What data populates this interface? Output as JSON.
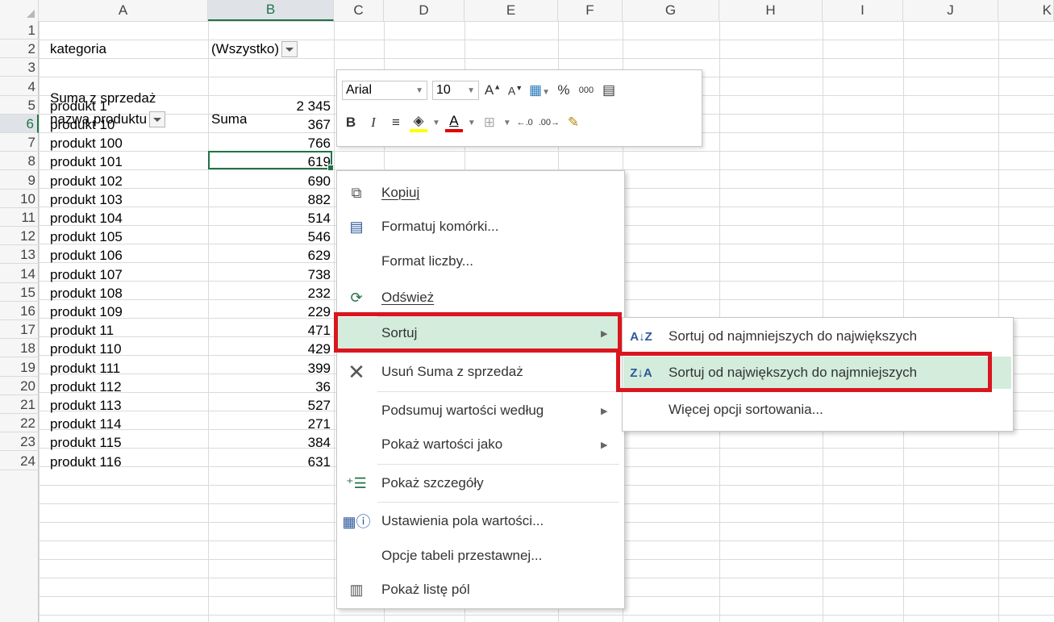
{
  "columns": [
    "A",
    "B",
    "C",
    "D",
    "E",
    "F",
    "G",
    "H",
    "I",
    "J",
    "K"
  ],
  "rows": [
    "1",
    "2",
    "3",
    "4",
    "5",
    "6",
    "7",
    "8",
    "9",
    "10",
    "11",
    "12",
    "13",
    "14",
    "15",
    "16",
    "17",
    "18",
    "19",
    "20",
    "21",
    "22",
    "23",
    "24"
  ],
  "cells": {
    "a1": "kategoria",
    "b1": "(Wszystko)",
    "a3": "Suma z sprzedaż",
    "a4": "nazwa produktu",
    "b4": "Suma",
    "data": [
      [
        "produkt 1",
        "2 345"
      ],
      [
        "produkt 10",
        "367"
      ],
      [
        "produkt 100",
        "766"
      ],
      [
        "produkt 101",
        "619"
      ],
      [
        "produkt 102",
        "690"
      ],
      [
        "produkt 103",
        "882"
      ],
      [
        "produkt 104",
        "514"
      ],
      [
        "produkt 105",
        "546"
      ],
      [
        "produkt 106",
        "629"
      ],
      [
        "produkt 107",
        "738"
      ],
      [
        "produkt 108",
        "232"
      ],
      [
        "produkt 109",
        "229"
      ],
      [
        "produkt 11",
        "471"
      ],
      [
        "produkt 110",
        "429"
      ],
      [
        "produkt 111",
        "399"
      ],
      [
        "produkt 112",
        "36"
      ],
      [
        "produkt 113",
        "527"
      ],
      [
        "produkt 114",
        "271"
      ],
      [
        "produkt 115",
        "384"
      ],
      [
        "produkt 116",
        "631"
      ]
    ]
  },
  "mini_toolbar": {
    "font": "Arial",
    "size": "10",
    "percent": "%",
    "thousands": "000",
    "bold": "B",
    "italic": "I",
    "font_color_letter": "A",
    "grow_letter": "A",
    "shrink_letter": "A"
  },
  "context_menu": {
    "copy": "Kopiuj",
    "format_cells": "Formatuj komórki...",
    "number_format": "Format liczby...",
    "refresh": "Odśwież",
    "sort": "Sortuj",
    "remove": "Usuń Suma z sprzedaż",
    "summarize": "Podsumuj wartości według",
    "show_values": "Pokaż wartości jako",
    "details": "Pokaż szczegóły",
    "field_settings": "Ustawienia pola wartości...",
    "pivot_options": "Opcje tabeli przestawnej...",
    "field_list": "Pokaż listę pól"
  },
  "sort_submenu": {
    "asc": "Sortuj od najmniejszych do największych",
    "desc": "Sortuj od największych do najmniejszych",
    "more": "Więcej opcji sortowania..."
  },
  "colors": {
    "accent": "#217346",
    "highlight": "#d3ecdc",
    "annotation": "#d9161f"
  }
}
